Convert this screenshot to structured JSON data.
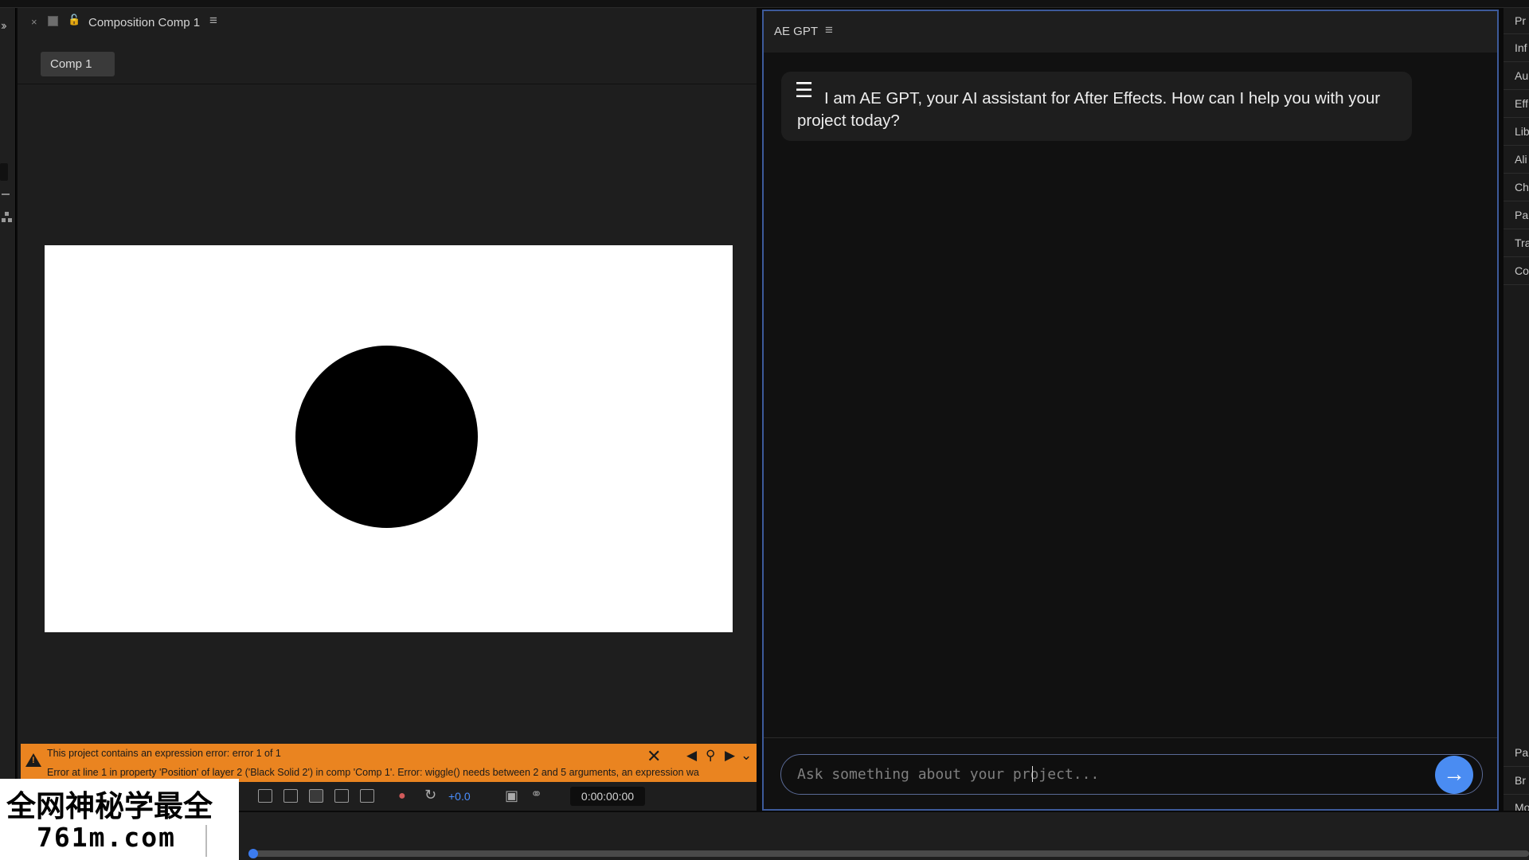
{
  "composition_panel": {
    "title": "Composition Comp 1",
    "comp_chip": "Comp 1"
  },
  "error_bar": {
    "line1": "This project contains an expression error: error 1 of 1",
    "line2": "Error at line 1 in property 'Position' of layer 2 ('Black Solid 2') in comp 'Comp 1'.  Error: wiggle() needs between 2 and 5 arguments, an expression wa"
  },
  "comp_toolbar": {
    "exposure": "+0.0",
    "timecode": "0:00:00:00"
  },
  "gpt_panel": {
    "title": "AE GPT",
    "assistant_message": "I am AE GPT, your AI assistant for After Effects. How can I help you with your project today?",
    "input_placeholder": "Ask something about your project..."
  },
  "right_panels": {
    "tabs": [
      "Pr",
      "Inf",
      "Au",
      "Eff",
      "Lib",
      "Ali",
      "Ch",
      "Pa",
      "Tra",
      "Co",
      "Pa",
      "Br",
      "Mo"
    ]
  },
  "watermark": {
    "line1": "全网神秘学最全",
    "line2": "761m.com"
  },
  "colors": {
    "accent_blue": "#4a8cf2",
    "error_orange": "#ea8420",
    "panel_border": "#3d5a9a"
  }
}
